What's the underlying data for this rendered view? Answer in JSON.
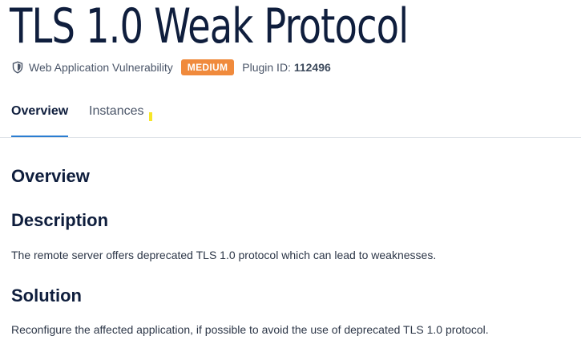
{
  "title": "TLS 1.0 Weak Protocol",
  "meta": {
    "icon": "shield-icon",
    "category": "Web Application Vulnerability",
    "severity": "MEDIUM",
    "severity_color": "#f08a3c",
    "plugin_label": "Plugin ID:",
    "plugin_id": "112496"
  },
  "tabs": [
    {
      "label": "Overview",
      "active": true
    },
    {
      "label": "Instances",
      "active": false
    }
  ],
  "content": {
    "overview_heading": "Overview",
    "description_heading": "Description",
    "description_text": "The remote server offers deprecated TLS 1.0 protocol which can lead to weaknesses.",
    "solution_heading": "Solution",
    "solution_text": "Reconfigure the affected application, if possible to avoid the use of deprecated TLS 1.0 protocol."
  },
  "colors": {
    "accent_tab_underline": "#2a7dd1",
    "heading": "#0f1e3d"
  }
}
